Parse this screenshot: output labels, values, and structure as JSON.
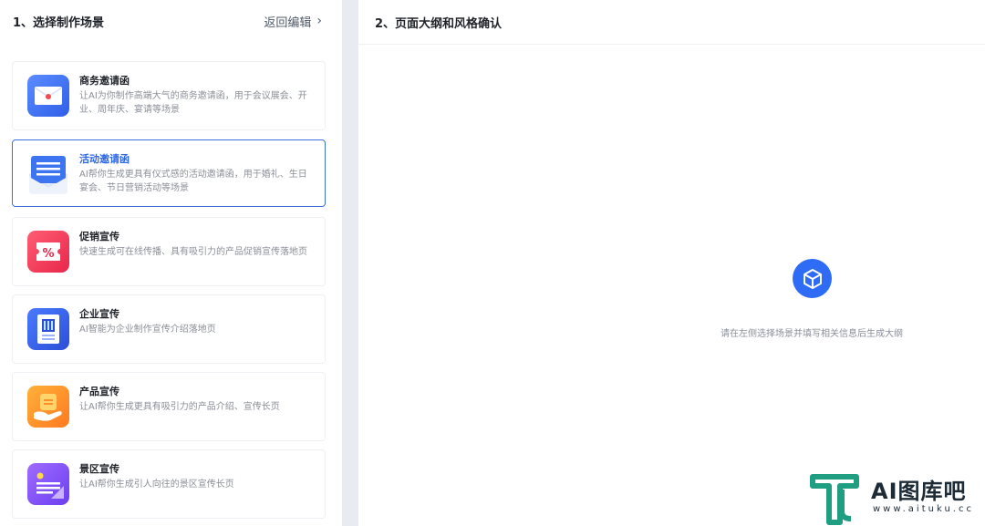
{
  "left_panel": {
    "title": "1、选择制作场景",
    "back_label": "返回编辑",
    "cards": [
      {
        "title": "商务邀请函",
        "desc": "让AI为你制作高端大气的商务邀请函，用于会议展会、开业、周年庆、宴请等场景",
        "icon": "envelope-icon",
        "selected": false
      },
      {
        "title": "活动邀请函",
        "desc": "AI帮你生成更具有仪式感的活动邀请函，用于婚礼、生日宴会、节日营销活动等场景",
        "icon": "document-envelope-icon",
        "selected": true
      },
      {
        "title": "促销宣传",
        "desc": "快速生成可在线传播、具有吸引力的产品促销宣传落地页",
        "icon": "percent-coupon-icon",
        "selected": false
      },
      {
        "title": "企业宣传",
        "desc": "AI智能为企业制作宣传介绍落地页",
        "icon": "building-document-icon",
        "selected": false
      },
      {
        "title": "产品宣传",
        "desc": "让AI帮你生成更具有吸引力的产品介绍、宣传长页",
        "icon": "product-box-icon",
        "selected": false
      },
      {
        "title": "景区宣传",
        "desc": "让AI帮你生成引人向往的景区宣传长页",
        "icon": "scenery-page-icon",
        "selected": false
      }
    ]
  },
  "right_panel": {
    "title": "2、页面大纲和风格确认",
    "empty_hint": "请在左侧选择场景并填写相关信息后生成大纲",
    "empty_icon": "cube-icon"
  },
  "watermark": {
    "name": "AI图库吧",
    "url": "www.aituku.cc"
  },
  "colors": {
    "accent": "#2f66e8",
    "selected_border": "#3a6fe0"
  }
}
